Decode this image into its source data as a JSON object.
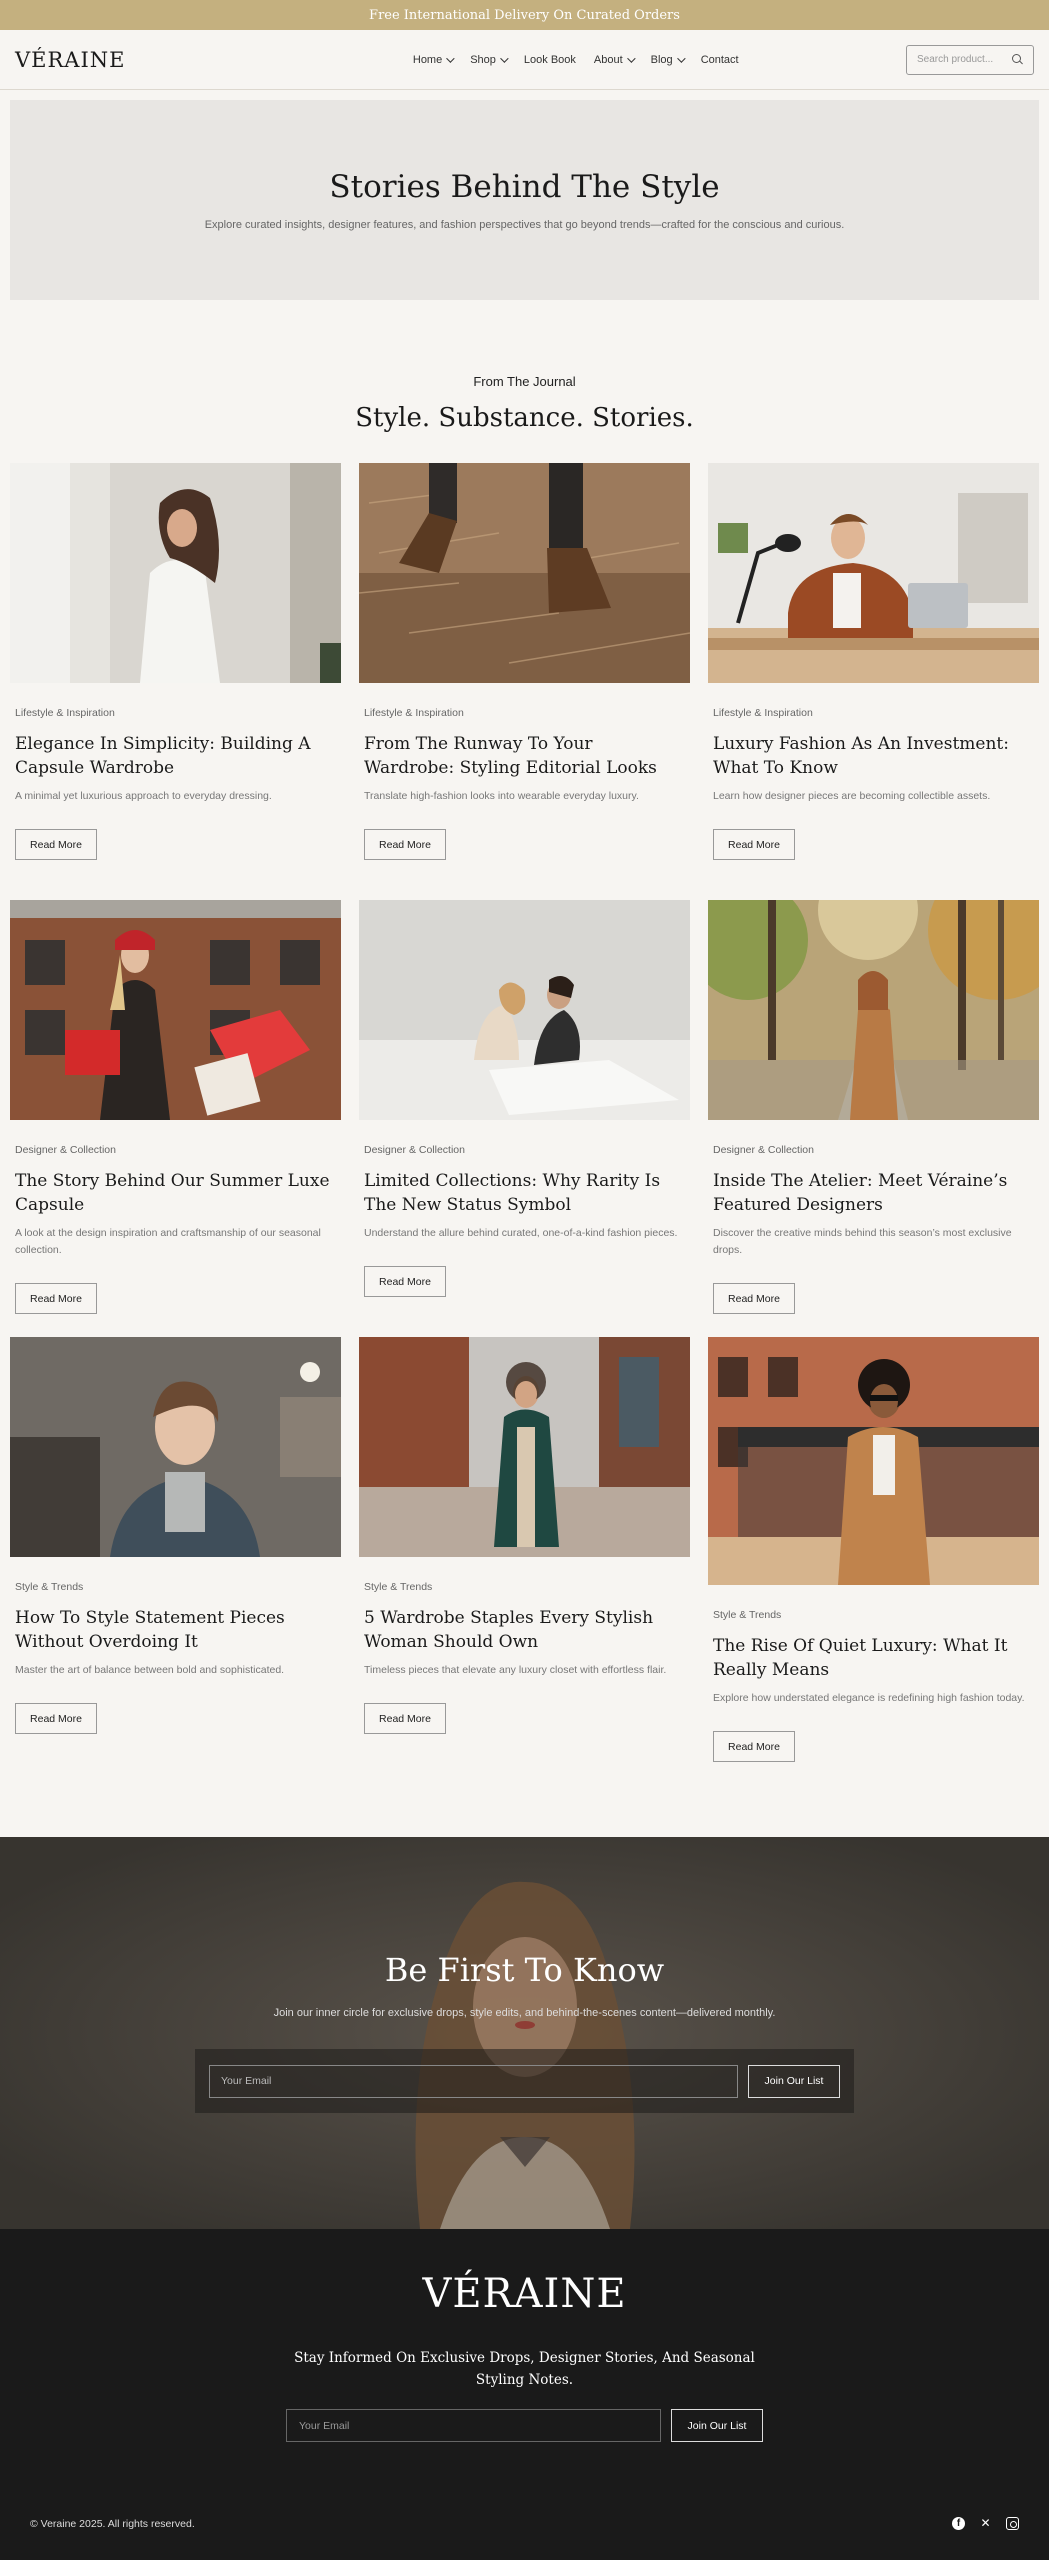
{
  "announcement": "Free International Delivery On Curated Orders",
  "header": {
    "logo": "VÉRAINE",
    "nav": [
      {
        "label": "Home",
        "dropdown": true
      },
      {
        "label": "Shop",
        "dropdown": true
      },
      {
        "label": "Look Book",
        "dropdown": false
      },
      {
        "label": "About",
        "dropdown": true
      },
      {
        "label": "Blog",
        "dropdown": true
      },
      {
        "label": "Contact",
        "dropdown": false
      }
    ],
    "search_placeholder": "Search product..."
  },
  "hero": {
    "title": "Stories Behind The Style",
    "subtitle": "Explore curated insights, designer features, and fashion perspectives that go beyond trends—crafted for the conscious and curious."
  },
  "journal": {
    "eyebrow": "From The Journal",
    "title": "Style. Substance. Stories.",
    "read_more": "Read More",
    "posts": [
      {
        "category": "Lifestyle & Inspiration",
        "title": "Elegance In Simplicity: Building A Capsule Wardrobe",
        "excerpt": "A minimal yet luxurious approach to everyday dressing."
      },
      {
        "category": "Lifestyle & Inspiration",
        "title": "From The Runway To Your Wardrobe: Styling Editorial Looks",
        "excerpt": "Translate high-fashion looks into wearable everyday luxury."
      },
      {
        "category": "Lifestyle & Inspiration",
        "title": "Luxury Fashion As An Investment: What To Know",
        "excerpt": "Learn how designer pieces are becoming collectible assets."
      },
      {
        "category": "Designer & Collection",
        "title": "The Story Behind Our Summer Luxe Capsule",
        "excerpt": "A look at the design inspiration and craftsmanship of our seasonal collection."
      },
      {
        "category": "Designer & Collection",
        "title": "Limited Collections: Why Rarity Is The New Status Symbol",
        "excerpt": "Understand the allure behind curated, one-of-a-kind fashion pieces."
      },
      {
        "category": "Designer & Collection",
        "title": "Inside The Atelier: Meet Véraine’s Featured Designers",
        "excerpt": "Discover the creative minds behind this season’s most exclusive drops."
      },
      {
        "category": "Style & Trends",
        "title": "How To Style Statement Pieces Without Overdoing It",
        "excerpt": "Master the art of balance between bold and sophisticated."
      },
      {
        "category": "Style & Trends",
        "title": "5 Wardrobe Staples Every Stylish Woman Should Own",
        "excerpt": "Timeless pieces that elevate any luxury closet with effortless flair."
      },
      {
        "category": "Style & Trends",
        "title": "The Rise Of Quiet Luxury: What It Really Means",
        "excerpt": "Explore how understated elegance is redefining high fashion today."
      }
    ]
  },
  "subscribe": {
    "title": "Be First To Know",
    "subtitle": "Join our inner circle for exclusive drops, style edits, and behind-the-scenes content—delivered monthly.",
    "placeholder": "Your Email",
    "button": "Join Our List"
  },
  "footer": {
    "logo": "VÉRAINE",
    "tagline": "Stay Informed On Exclusive Drops, Designer Stories, And Seasonal Styling Notes.",
    "placeholder": "Your Email",
    "button": "Join Our List",
    "copyright": "© Veraine 2025. All rights reserved.",
    "socials": [
      "facebook-icon",
      "x-icon",
      "instagram-icon"
    ]
  }
}
